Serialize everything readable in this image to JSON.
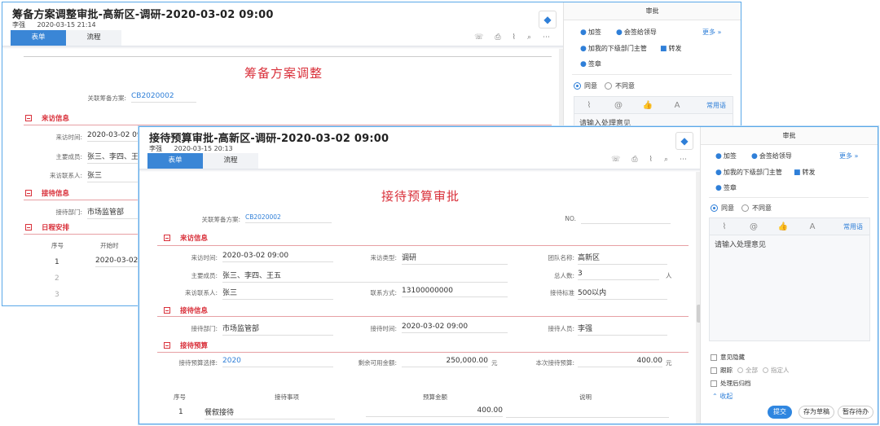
{
  "back": {
    "title": "筹备方案调整审批-高新区-调研-2020-03-02 09:00",
    "user": "李强",
    "time": "2020-03-15 21:14",
    "tabs": [
      "表单",
      "流程"
    ],
    "doc_title": "筹备方案调整",
    "related_label": "关联筹备方案:",
    "related_value": "CB2020002",
    "sections": [
      "来访信息",
      "接待信息",
      "日程安排"
    ],
    "visit_time_label": "来访时间:",
    "visit_time_value": "2020-03-02 09",
    "members_label": "主要成员:",
    "members_value": "张三、李四、王",
    "contact_label": "来访联系人:",
    "contact_value": "张三",
    "dept_label": "接待部门:",
    "dept_value": "市场监管部",
    "sched_cols": [
      "序号",
      "开始时"
    ],
    "sched_rows": [
      "1",
      "2",
      "3"
    ],
    "sched_first": "2020-03-02",
    "side": {
      "head": "审批",
      "actions": [
        "加签",
        "会签给领导",
        "加我的下级部门主管",
        "转发",
        "签章"
      ],
      "more": "更多",
      "agree": "同意",
      "disagree": "不同意",
      "phrases": "常用语",
      "placeholder": "请输入处理意见"
    }
  },
  "front": {
    "title": "接待预算审批-高新区-调研-2020-03-02 09:00",
    "user": "李强",
    "time": "2020-03-15 20:13",
    "tabs": [
      "表单",
      "流程"
    ],
    "doc_title": "接待预算审批",
    "related_label": "关联筹备方案:",
    "related_value": "CB2020002",
    "no_label": "NO.",
    "sections": [
      "来访信息",
      "接待信息",
      "接待预算"
    ],
    "visit_time_label": "来访时间:",
    "visit_time_value": "2020-03-02 09:00",
    "visit_type_label": "来访类型:",
    "visit_type_value": "调研",
    "team_label": "团队名称:",
    "team_value": "高新区",
    "members_label": "主要成员:",
    "members_value": "张三、李四、王五",
    "total_label": "总人数:",
    "total_value": "3",
    "total_unit": "人",
    "contact_label": "来访联系人:",
    "contact_value": "张三",
    "phone_label": "联系方式:",
    "phone_value": "13100000000",
    "standard_label": "接待标准",
    "standard_value": "500以内",
    "dept_label": "接待部门:",
    "dept_value": "市场监管部",
    "recv_time_label": "接待时间:",
    "recv_time_value": "2020-03-02 09:00",
    "recv_person_label": "接待人员:",
    "recv_person_value": "李强",
    "budget_select_label": "接待预算选择:",
    "budget_select_value": "2020",
    "remaining_label": "剩余可用金额:",
    "remaining_value": "250,000.00",
    "remaining_unit": "元",
    "this_budget_label": "本次接待预算:",
    "this_budget_value": "400.00",
    "this_budget_unit": "元",
    "budget_cols": [
      "序号",
      "接待事项",
      "预算金额",
      "说明"
    ],
    "budget_rows": [
      {
        "no": "1",
        "item": "餐叙接待",
        "amount": "400.00"
      }
    ],
    "side": {
      "head": "审批",
      "actions": [
        "加签",
        "会签给领导",
        "加我的下级部门主管",
        "转发",
        "签章"
      ],
      "more": "更多",
      "agree": "同意",
      "disagree": "不同意",
      "phrases": "常用语",
      "placeholder": "请输入处理意见",
      "hide_opinion": "意见隐藏",
      "follow": "跟踪",
      "follow_all": "全部",
      "follow_assign": "指定人",
      "archive": "处理后归档",
      "collapse": "收起",
      "submit": "提交",
      "save_draft": "存为草稿",
      "hold": "暂存待办"
    }
  },
  "colors": {
    "accent": "#3a86d6",
    "section_red": "#d9303a",
    "link_blue": "#2f7fd8"
  }
}
